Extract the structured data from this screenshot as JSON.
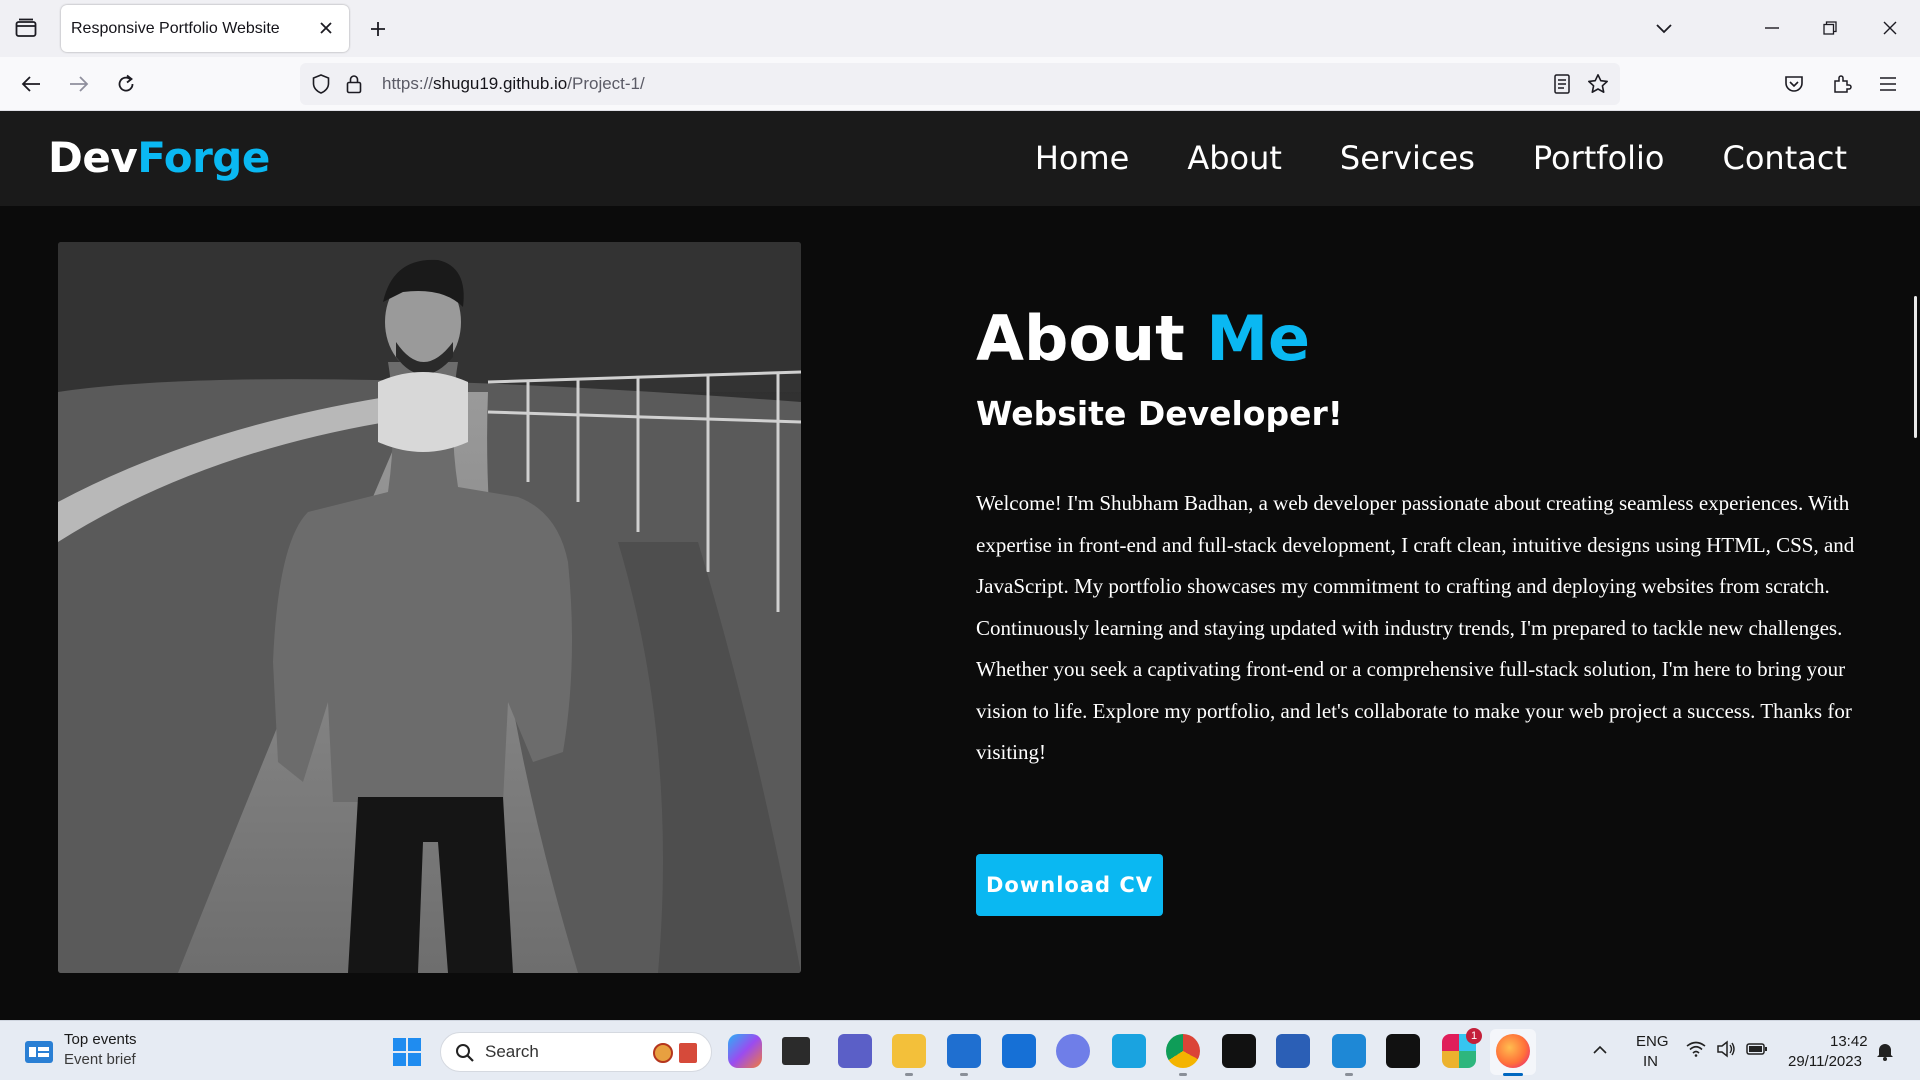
{
  "browser": {
    "tab_title": "Responsive Portfolio Website",
    "url_scheme": "https://",
    "url_host": "shugu19.github.io",
    "url_path": "/Project-1/"
  },
  "site": {
    "logo_part1": "Dev",
    "logo_part2": "Forge",
    "nav": [
      "Home",
      "About",
      "Services",
      "Portfolio",
      "Contact"
    ],
    "accent_color": "#0ab8f2"
  },
  "about": {
    "title_part1": "About ",
    "title_part2": "Me",
    "subtitle": "Website Developer!",
    "paragraph": "Welcome! I'm Shubham Badhan, a web developer passionate about creating seamless experiences. With expertise in front-end and full-stack development, I craft clean, intuitive designs using HTML, CSS, and JavaScript. My portfolio showcases my commitment to crafting and deploying websites from scratch. Continuously learning and staying updated with industry trends, I'm prepared to tackle new challenges. Whether you seek a captivating front-end or a comprehensive full-stack solution, I'm here to bring your vision to life. Explore my portfolio, and let's collaborate to make your web project a success. Thanks for visiting!",
    "button_label": "Download CV"
  },
  "taskbar": {
    "widget_title": "Top events",
    "widget_subtitle": "Event brief",
    "search_placeholder": "Search",
    "lang_line1": "ENG",
    "lang_line2": "IN",
    "time": "13:42",
    "date": "29/11/2023",
    "slack_badge": "1"
  }
}
